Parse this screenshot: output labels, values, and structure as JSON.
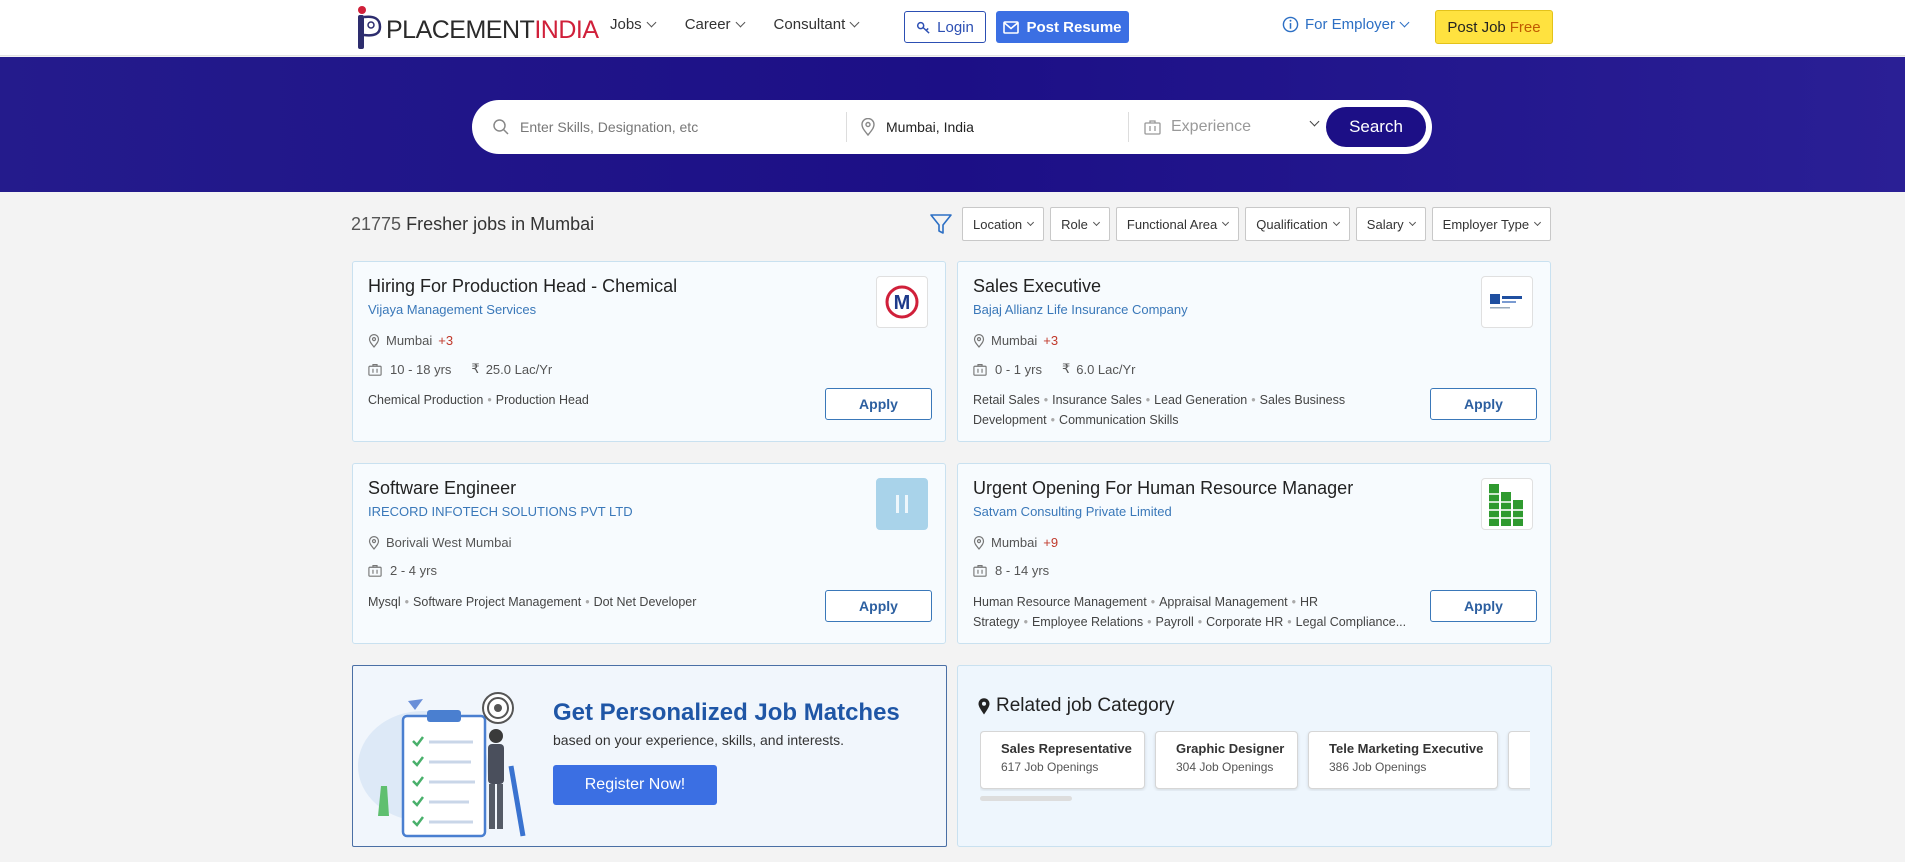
{
  "brand": {
    "logo_a": "PLACEMENT",
    "logo_b": "INDIA"
  },
  "nav": {
    "items": [
      {
        "label": "Jobs"
      },
      {
        "label": "Career"
      },
      {
        "label": "Consultant"
      }
    ],
    "login": "Login",
    "post_resume": "Post Resume",
    "for_employer": "For Employer",
    "post_job": "Post Job",
    "post_job_free": "Free"
  },
  "search": {
    "skills_placeholder": "Enter Skills, Designation, etc",
    "location_value": "Mumbai, India",
    "experience_placeholder": "Experience",
    "button": "Search"
  },
  "results": {
    "count": "21775",
    "title": "Fresher jobs in Mumbai"
  },
  "filters": [
    "Location",
    "Role",
    "Functional Area",
    "Qualification",
    "Salary",
    "Employer Type"
  ],
  "jobs": [
    {
      "title": "Hiring For Production Head - Chemical",
      "company": "Vijaya Management Services",
      "location": "Mumbai",
      "more_locations": "+3",
      "experience": "10 - 18 yrs",
      "salary": "25.0 Lac/Yr",
      "skills": [
        "Chemical Production",
        "Production Head"
      ],
      "apply": "Apply"
    },
    {
      "title": "Sales Executive",
      "company": "Bajaj Allianz Life Insurance Company",
      "location": "Mumbai",
      "more_locations": "+3",
      "experience": "0 - 1 yrs",
      "salary": "6.0 Lac/Yr",
      "skills": [
        "Retail Sales",
        "Insurance Sales",
        "Lead Generation",
        "Sales Business Development",
        "Communication Skills"
      ],
      "apply": "Apply"
    },
    {
      "title": "Software Engineer",
      "company": "IRECORD INFOTECH SOLUTIONS PVT LTD",
      "location": "Borivali West Mumbai",
      "more_locations": "",
      "experience": "2 - 4 yrs",
      "salary": "",
      "skills": [
        "Mysql",
        "Software Project Management",
        "Dot Net Developer"
      ],
      "apply": "Apply"
    },
    {
      "title": "Urgent Opening For Human Resource Manager",
      "company": "Satvam Consulting Private Limited",
      "location": "Mumbai",
      "more_locations": "+9",
      "experience": "8 - 14 yrs",
      "salary": "",
      "skills": [
        "Human Resource Management",
        "Appraisal Management",
        "HR Strategy",
        "Employee Relations",
        "Payroll",
        "Corporate HR",
        "Legal Compliance..."
      ],
      "apply": "Apply"
    }
  ],
  "promo": {
    "title": "Get Personalized Job Matches",
    "subtitle": "based on your experience, skills, and interests.",
    "button": "Register Now!"
  },
  "related": {
    "title": "Related job Category",
    "categories": [
      {
        "name": "Sales Representative",
        "count": "617 Job Openings"
      },
      {
        "name": "Graphic Designer",
        "count": "304 Job Openings"
      },
      {
        "name": "Tele Marketing Executive",
        "count": "386 Job Openings"
      }
    ]
  },
  "colors": {
    "hero": "#1c0f86",
    "primary": "#3b6fe3",
    "link": "#3a78b9",
    "accent_red": "#d0203a",
    "post_job_bg": "#ffe23f"
  }
}
